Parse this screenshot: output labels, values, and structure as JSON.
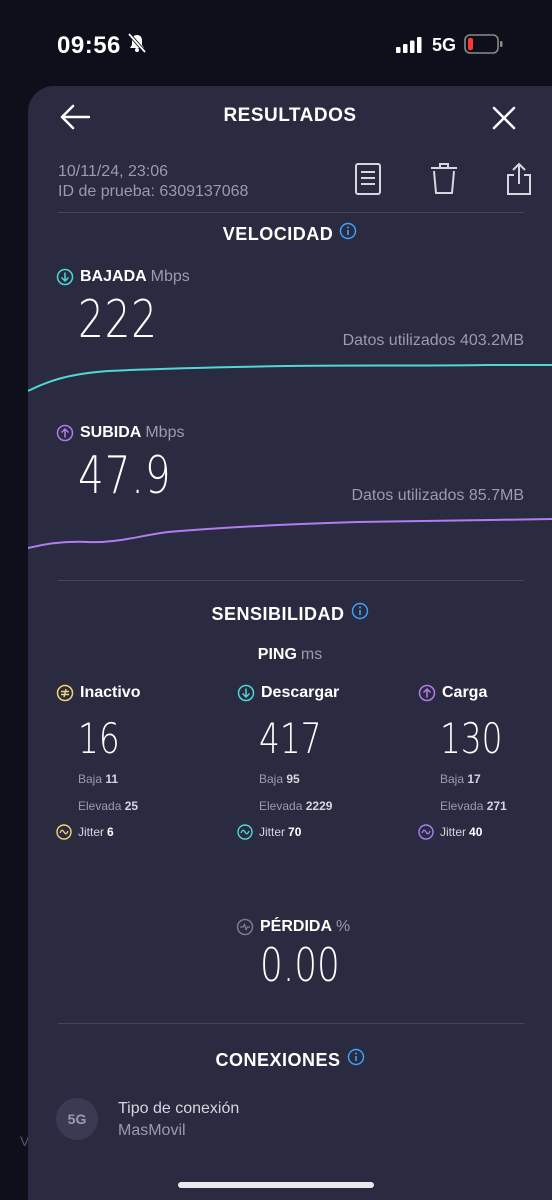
{
  "status_bar": {
    "time": "09:56",
    "network": "5G"
  },
  "header": {
    "title": "RESULTADOS"
  },
  "meta": {
    "date": "10/11/24, 23:06",
    "test_id": "ID de prueba: 6309137068"
  },
  "velocidad": {
    "title": "VELOCIDAD",
    "download": {
      "label": "BAJADA",
      "unit": "Mbps",
      "value": "222",
      "data_used": "Datos utilizados 403.2MB",
      "color": "#4fd8d8"
    },
    "upload": {
      "label": "SUBIDA",
      "unit": "Mbps",
      "value": "47.9",
      "data_used": "Datos utilizados 85.7MB",
      "color": "#b27cf0"
    }
  },
  "sensibilidad": {
    "title": "SENSIBILIDAD",
    "ping_label": "PING",
    "ping_unit": "ms",
    "columns": [
      {
        "label": "Inactivo",
        "value": "16",
        "low_label": "Baja",
        "low": "11",
        "high_label": "Elevada",
        "high": "25",
        "jitter_label": "Jitter",
        "jitter": "6",
        "color": "#f0d870"
      },
      {
        "label": "Descargar",
        "value": "417",
        "low_label": "Baja",
        "low": "95",
        "high_label": "Elevada",
        "high": "2229",
        "jitter_label": "Jitter",
        "jitter": "70",
        "color": "#4fd8d8"
      },
      {
        "label": "Carga",
        "value": "130",
        "low_label": "Baja",
        "low": "17",
        "high_label": "Elevada",
        "high": "271",
        "jitter_label": "Jitter",
        "jitter": "40",
        "color": "#b27cf0"
      }
    ]
  },
  "perdida": {
    "label": "PÉRDIDA",
    "unit": "%",
    "value": "0.00"
  },
  "conexiones": {
    "title": "CONEXIONES",
    "badge": "5G",
    "type_label": "Tipo de conexión",
    "type_value": "MasMovil"
  },
  "peek_text": "V",
  "colors": {
    "sheet": "#2a2a40",
    "background": "#0d0f1a",
    "info": "#3ea6ff"
  }
}
